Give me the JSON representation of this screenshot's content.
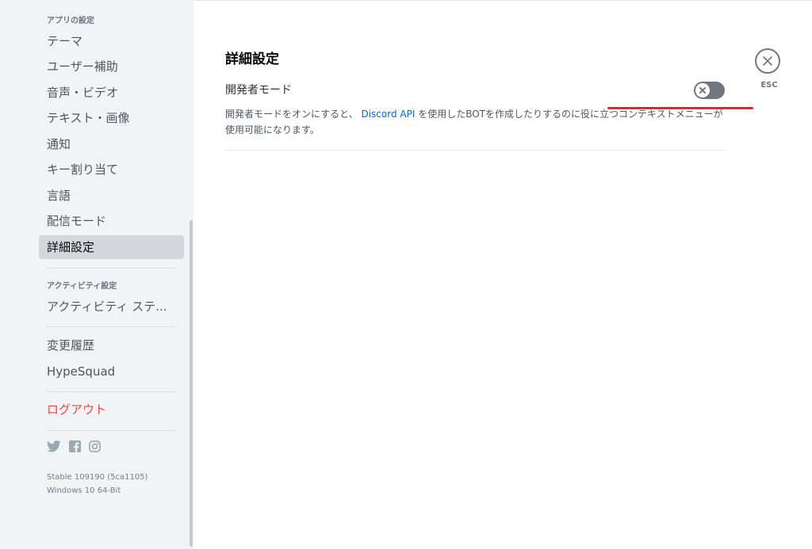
{
  "sidebar": {
    "app_settings_header": "アプリの設定",
    "app_items": [
      {
        "label": "テーマ"
      },
      {
        "label": "ユーザー補助"
      },
      {
        "label": "音声・ビデオ"
      },
      {
        "label": "テキスト・画像"
      },
      {
        "label": "通知"
      },
      {
        "label": "キー割り当て"
      },
      {
        "label": "言語"
      },
      {
        "label": "配信モード"
      },
      {
        "label": "詳細設定",
        "selected": true
      }
    ],
    "activity_header": "アクティビティ設定",
    "activity_items": [
      {
        "label": "アクティビティ ステ..."
      }
    ],
    "misc_items": [
      {
        "label": "変更履歴"
      },
      {
        "label": "HypeSquad"
      }
    ],
    "logout_label": "ログアウト",
    "social_icons": [
      "twitter-icon",
      "facebook-icon",
      "instagram-icon"
    ],
    "version_line1": "Stable 109190 (5ca1105)",
    "version_line2": "Windows 10 64-Bit"
  },
  "main": {
    "title": "詳細設定",
    "developer_mode": {
      "label": "開発者モード",
      "enabled": false,
      "desc_before": "開発者モードをオンにすると、",
      "desc_link": "Discord API",
      "desc_after": " を使用したBOTを作成したりするのに役に立つコンテキストメニューが使用可能になります。"
    },
    "close_label": "ESC"
  },
  "colors": {
    "sidebar_bg": "#f2f3f5",
    "selected_bg": "#d4d7dc",
    "danger": "#ed4245",
    "link": "#0068e0",
    "toggle_off": "#72767d",
    "annotation": "#e0262f"
  }
}
